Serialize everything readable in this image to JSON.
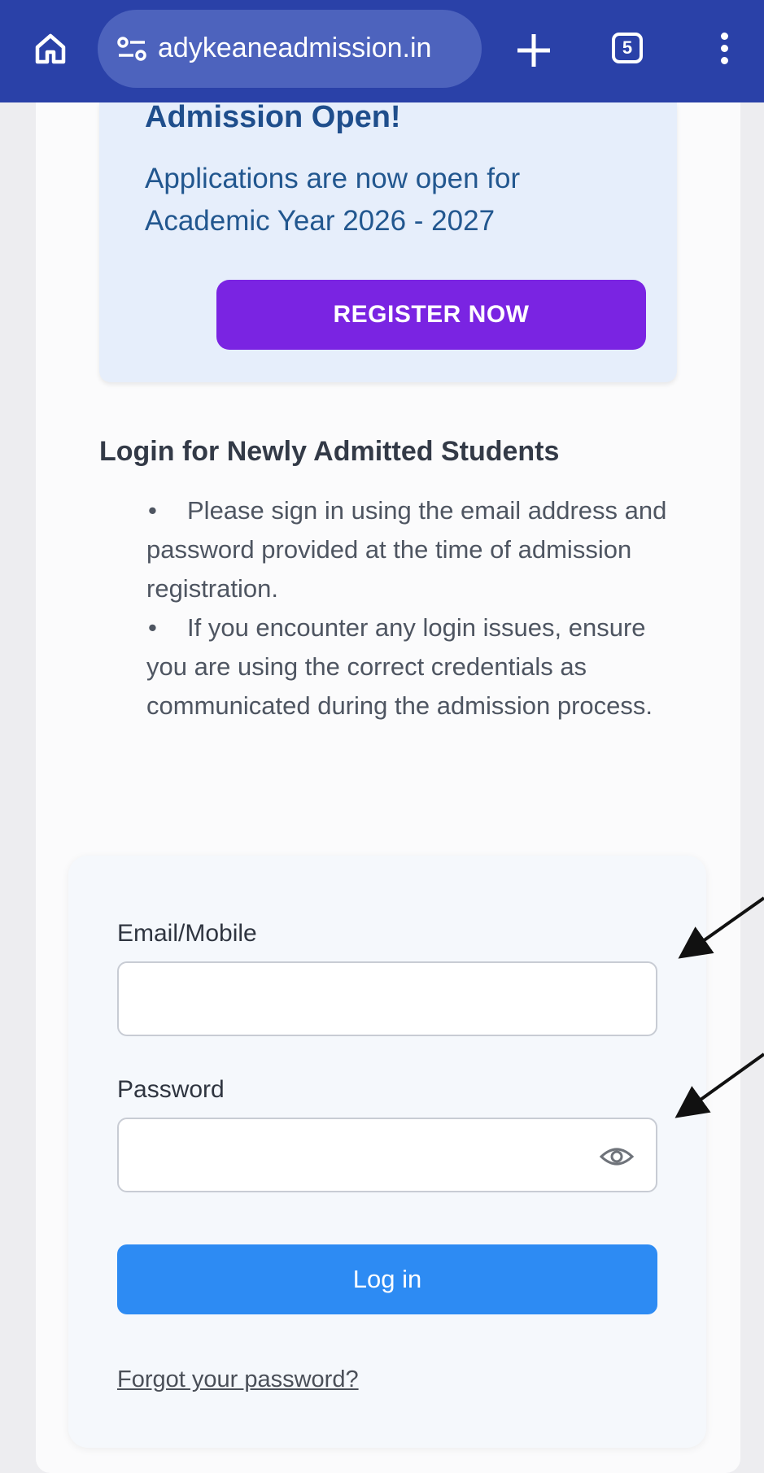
{
  "browser": {
    "url": "adykeaneadmission.in",
    "tab_count": "5",
    "colors": {
      "toolbar": "#2a41a8",
      "url_pill": "#4d63bd"
    }
  },
  "banner": {
    "title": "Admission Open!",
    "text": "Applications are now open for Academic Year 2026 - 2027",
    "register_label": "REGISTER NOW",
    "colors": {
      "background": "#e6eefb",
      "button": "#7a24e2"
    }
  },
  "login_info": {
    "heading": "Login for Newly Admitted Students",
    "bullets": [
      "Please sign in using the email address and password provided at the time of admission registration.",
      "If you encounter any login issues, ensure you are using the correct credentials as communicated during the admission process."
    ]
  },
  "login_form": {
    "email_label": "Email/Mobile",
    "email_value": "",
    "password_label": "Password",
    "password_value": "",
    "login_label": "Log in",
    "forgot_label": "Forgot your password?",
    "colors": {
      "login_button": "#2d8bf3"
    }
  },
  "icons": [
    "home-icon",
    "site-settings-icon",
    "plus-icon",
    "tab-switcher-icon",
    "more-vert-icon",
    "eye-icon",
    "arrow-icon"
  ]
}
